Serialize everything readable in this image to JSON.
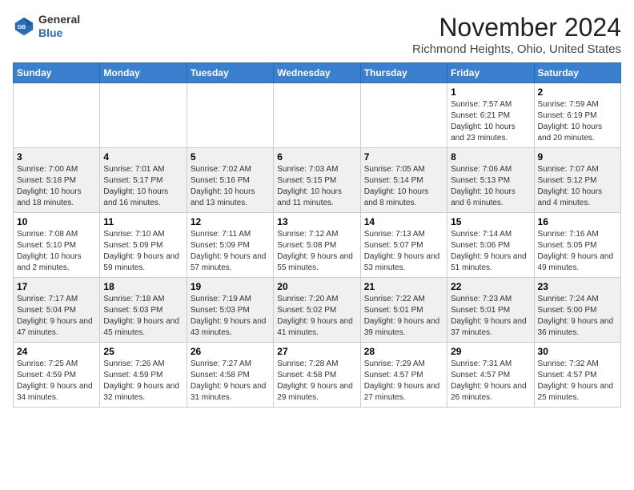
{
  "header": {
    "logo_general": "General",
    "logo_blue": "Blue",
    "month": "November 2024",
    "location": "Richmond Heights, Ohio, United States"
  },
  "days_of_week": [
    "Sunday",
    "Monday",
    "Tuesday",
    "Wednesday",
    "Thursday",
    "Friday",
    "Saturday"
  ],
  "weeks": [
    [
      {
        "day": "",
        "info": ""
      },
      {
        "day": "",
        "info": ""
      },
      {
        "day": "",
        "info": ""
      },
      {
        "day": "",
        "info": ""
      },
      {
        "day": "",
        "info": ""
      },
      {
        "day": "1",
        "info": "Sunrise: 7:57 AM\nSunset: 6:21 PM\nDaylight: 10 hours\nand 23 minutes."
      },
      {
        "day": "2",
        "info": "Sunrise: 7:59 AM\nSunset: 6:19 PM\nDaylight: 10 hours\nand 20 minutes."
      }
    ],
    [
      {
        "day": "3",
        "info": "Sunrise: 7:00 AM\nSunset: 5:18 PM\nDaylight: 10 hours\nand 18 minutes."
      },
      {
        "day": "4",
        "info": "Sunrise: 7:01 AM\nSunset: 5:17 PM\nDaylight: 10 hours\nand 16 minutes."
      },
      {
        "day": "5",
        "info": "Sunrise: 7:02 AM\nSunset: 5:16 PM\nDaylight: 10 hours\nand 13 minutes."
      },
      {
        "day": "6",
        "info": "Sunrise: 7:03 AM\nSunset: 5:15 PM\nDaylight: 10 hours\nand 11 minutes."
      },
      {
        "day": "7",
        "info": "Sunrise: 7:05 AM\nSunset: 5:14 PM\nDaylight: 10 hours\nand 8 minutes."
      },
      {
        "day": "8",
        "info": "Sunrise: 7:06 AM\nSunset: 5:13 PM\nDaylight: 10 hours\nand 6 minutes."
      },
      {
        "day": "9",
        "info": "Sunrise: 7:07 AM\nSunset: 5:12 PM\nDaylight: 10 hours\nand 4 minutes."
      }
    ],
    [
      {
        "day": "10",
        "info": "Sunrise: 7:08 AM\nSunset: 5:10 PM\nDaylight: 10 hours\nand 2 minutes."
      },
      {
        "day": "11",
        "info": "Sunrise: 7:10 AM\nSunset: 5:09 PM\nDaylight: 9 hours\nand 59 minutes."
      },
      {
        "day": "12",
        "info": "Sunrise: 7:11 AM\nSunset: 5:09 PM\nDaylight: 9 hours\nand 57 minutes."
      },
      {
        "day": "13",
        "info": "Sunrise: 7:12 AM\nSunset: 5:08 PM\nDaylight: 9 hours\nand 55 minutes."
      },
      {
        "day": "14",
        "info": "Sunrise: 7:13 AM\nSunset: 5:07 PM\nDaylight: 9 hours\nand 53 minutes."
      },
      {
        "day": "15",
        "info": "Sunrise: 7:14 AM\nSunset: 5:06 PM\nDaylight: 9 hours\nand 51 minutes."
      },
      {
        "day": "16",
        "info": "Sunrise: 7:16 AM\nSunset: 5:05 PM\nDaylight: 9 hours\nand 49 minutes."
      }
    ],
    [
      {
        "day": "17",
        "info": "Sunrise: 7:17 AM\nSunset: 5:04 PM\nDaylight: 9 hours\nand 47 minutes."
      },
      {
        "day": "18",
        "info": "Sunrise: 7:18 AM\nSunset: 5:03 PM\nDaylight: 9 hours\nand 45 minutes."
      },
      {
        "day": "19",
        "info": "Sunrise: 7:19 AM\nSunset: 5:03 PM\nDaylight: 9 hours\nand 43 minutes."
      },
      {
        "day": "20",
        "info": "Sunrise: 7:20 AM\nSunset: 5:02 PM\nDaylight: 9 hours\nand 41 minutes."
      },
      {
        "day": "21",
        "info": "Sunrise: 7:22 AM\nSunset: 5:01 PM\nDaylight: 9 hours\nand 39 minutes."
      },
      {
        "day": "22",
        "info": "Sunrise: 7:23 AM\nSunset: 5:01 PM\nDaylight: 9 hours\nand 37 minutes."
      },
      {
        "day": "23",
        "info": "Sunrise: 7:24 AM\nSunset: 5:00 PM\nDaylight: 9 hours\nand 36 minutes."
      }
    ],
    [
      {
        "day": "24",
        "info": "Sunrise: 7:25 AM\nSunset: 4:59 PM\nDaylight: 9 hours\nand 34 minutes."
      },
      {
        "day": "25",
        "info": "Sunrise: 7:26 AM\nSunset: 4:59 PM\nDaylight: 9 hours\nand 32 minutes."
      },
      {
        "day": "26",
        "info": "Sunrise: 7:27 AM\nSunset: 4:58 PM\nDaylight: 9 hours\nand 31 minutes."
      },
      {
        "day": "27",
        "info": "Sunrise: 7:28 AM\nSunset: 4:58 PM\nDaylight: 9 hours\nand 29 minutes."
      },
      {
        "day": "28",
        "info": "Sunrise: 7:29 AM\nSunset: 4:57 PM\nDaylight: 9 hours\nand 27 minutes."
      },
      {
        "day": "29",
        "info": "Sunrise: 7:31 AM\nSunset: 4:57 PM\nDaylight: 9 hours\nand 26 minutes."
      },
      {
        "day": "30",
        "info": "Sunrise: 7:32 AM\nSunset: 4:57 PM\nDaylight: 9 hours\nand 25 minutes."
      }
    ]
  ]
}
